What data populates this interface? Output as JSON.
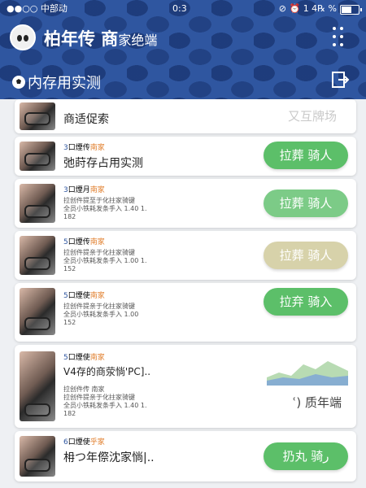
{
  "status_bar": {
    "carrier": "●●○○ 中部动",
    "time": "0:3",
    "indicators": "⊘ ⏰ 1 4℞ %",
    "battery_level": 0.6
  },
  "app_bar": {
    "title": "柏年传 商",
    "title_suffix": "家绝端",
    "more_icon": "more-dots-icon"
  },
  "section": {
    "title": "内存用实测",
    "exit_icon": "exit-icon"
  },
  "cards": [
    {
      "title": "商适促索",
      "side_label": "又互牌场",
      "button": ""
    },
    {
      "tag": "3",
      "meta": "口煙传",
      "vendor": "南家",
      "title": "弛莳存占用实测",
      "button": "拉葬 骑人"
    },
    {
      "tag": "3",
      "meta": "口煙月",
      "vendor": "南家",
      "desc": [
        "拉创件提至于化拄家骑键",
        "全员小铁耗发条手入 1.40 1.",
        "182"
      ],
      "button": "拉葬 骑人"
    },
    {
      "tag": "5",
      "meta": "口煙传",
      "vendor": "南家",
      "desc": [
        "拉创件提亲于化拄家骑键",
        "全员小铁耗发条手入 1.00 1.",
        "152"
      ],
      "button": "拉葬 骑人"
    },
    {
      "tag": "5",
      "meta": "口煙使",
      "vendor": "南家",
      "desc": [
        "拉创件提亲于化拄家骑键",
        "全员小铁耗发条手入 1.00",
        "152"
      ],
      "button": "拉弃 骑入"
    },
    {
      "tag": "5",
      "meta": "口煙使",
      "vendor": "南家",
      "title": "V4存的商荥惝'PC]..",
      "desc": [
        "拉创件传 南家",
        "拉创件提亲于化拄家骑键",
        "全员小铁耗发条手入 1.40 1.",
        "182"
      ],
      "side_label": "ՙ) 质年端"
    },
    {
      "tag": "6",
      "meta": "口煙使",
      "vendor": "乎家",
      "title": "枏つ年傺沈家惝|..",
      "button": "扔丸 骑ر"
    }
  ]
}
